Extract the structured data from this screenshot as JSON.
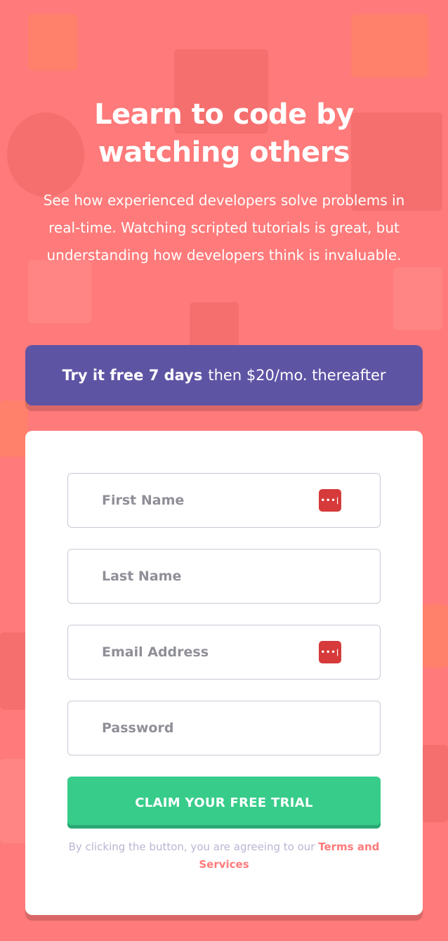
{
  "hero": {
    "title": "Learn to code by watching others",
    "description": "See how experienced developers solve problems in real-time. Watching scripted tutorials is great, but understanding how developers think is invaluable."
  },
  "offer": {
    "bold": "Try it free 7 days",
    "rest": "then $20/mo. thereafter"
  },
  "form": {
    "first_name_placeholder": "First Name",
    "last_name_placeholder": "Last Name",
    "email_placeholder": "Email Address",
    "password_placeholder": "Password",
    "password_manager_glyph": "•••|",
    "submit_label": "CLAIM YOUR FREE TRIAL",
    "terms_text": "By clicking the button, you are agreeing to our",
    "terms_link": "Terms and Services"
  },
  "colors": {
    "background": "#ff7a7a",
    "offer": "#5e54a4",
    "cta": "#38cc8b",
    "password_manager_icon": "#d63a3a"
  }
}
